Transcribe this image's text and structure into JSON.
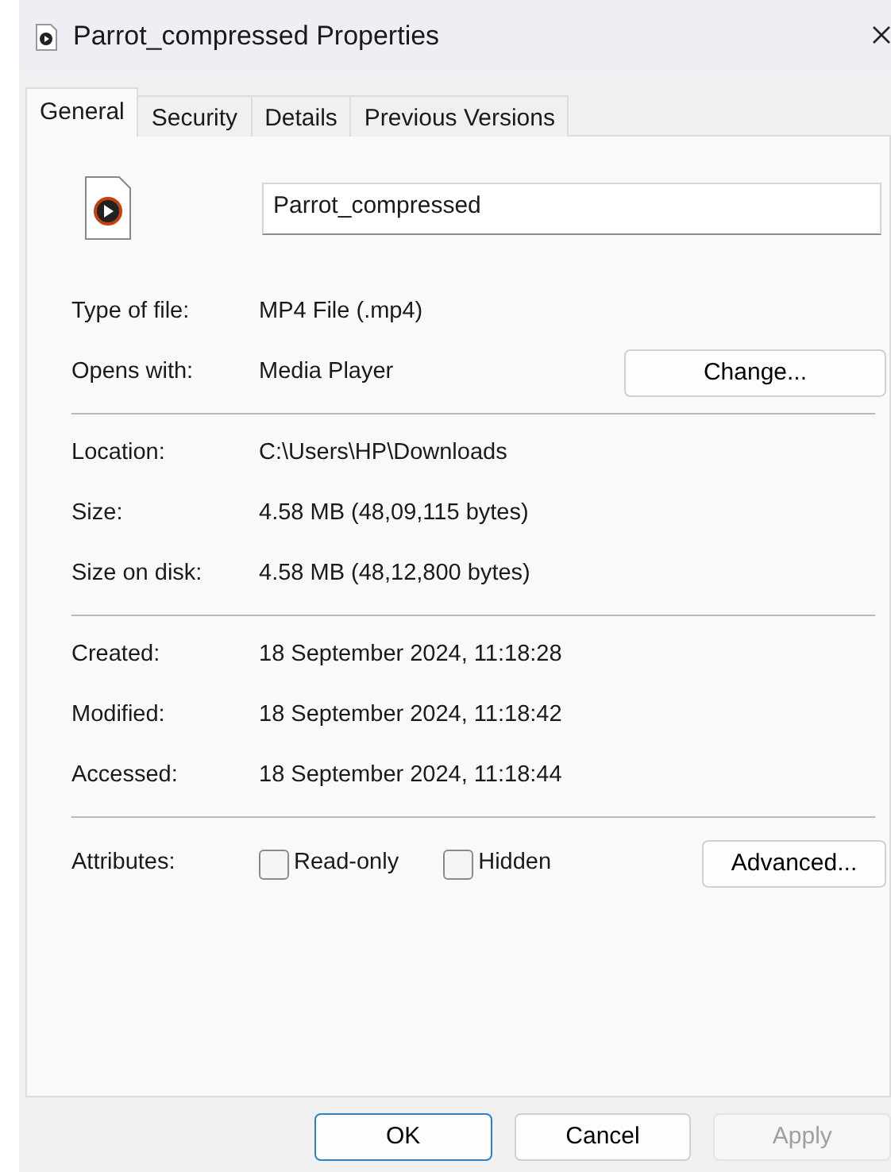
{
  "window": {
    "title": "Parrot_compressed Properties"
  },
  "tabs": [
    {
      "label": "General",
      "selected": true
    },
    {
      "label": "Security",
      "selected": false
    },
    {
      "label": "Details",
      "selected": false
    },
    {
      "label": "Previous Versions",
      "selected": false
    }
  ],
  "file_name": {
    "value": "Parrot_compressed"
  },
  "sections": [
    {
      "rows": [
        {
          "label": "Type of file:",
          "value": "MP4 File (.mp4)"
        },
        {
          "label": "Opens with:",
          "value": "Media Player",
          "button": "Change..."
        }
      ]
    },
    {
      "rows": [
        {
          "label": "Location:",
          "value": "C:\\Users\\HP\\Downloads"
        },
        {
          "label": "Size:",
          "value": "4.58 MB (48,09,115 bytes)"
        },
        {
          "label": "Size on disk:",
          "value": "4.58 MB (48,12,800 bytes)"
        }
      ]
    },
    {
      "rows": [
        {
          "label": "Created:",
          "value": "18 September 2024, 11:18:28"
        },
        {
          "label": "Modified:",
          "value": "18 September 2024, 11:18:42"
        },
        {
          "label": "Accessed:",
          "value": "18 September 2024, 11:18:44"
        }
      ]
    }
  ],
  "attributes": {
    "label": "Attributes:",
    "checkboxes": [
      {
        "label": "Read-only",
        "checked": false
      },
      {
        "label": "Hidden",
        "checked": false
      }
    ],
    "button": "Advanced..."
  },
  "buttons": [
    {
      "label": "OK",
      "default": true,
      "disabled": false
    },
    {
      "label": "Cancel",
      "default": false,
      "disabled": false
    },
    {
      "label": "Apply",
      "default": false,
      "disabled": true
    }
  ]
}
